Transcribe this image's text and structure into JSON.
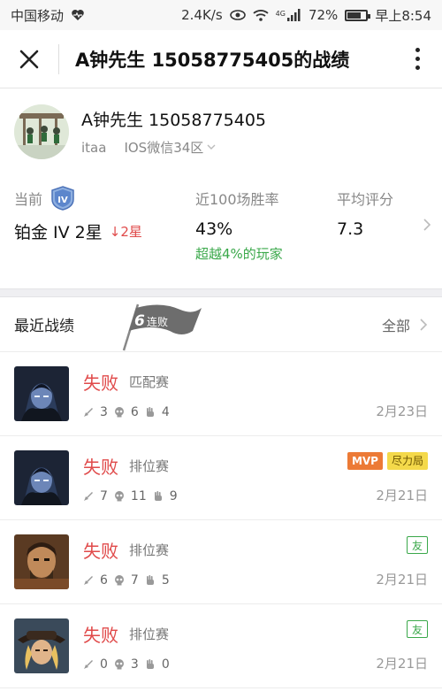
{
  "status_bar": {
    "carrier": "中国移动",
    "speed": "2.4K/s",
    "network": "4G",
    "battery": "72%",
    "battery_level": 0.72,
    "time": "早上8:54"
  },
  "navbar": {
    "title": "A钟先生 15058775405的战绩"
  },
  "profile": {
    "name": "A钟先生 15058775405",
    "account": "itaa",
    "server": "IOS微信34区",
    "rank_label": "当前",
    "rank_badge": "IV",
    "rank_value": "铂金 IV 2星",
    "rank_change": "↓2星",
    "winrate_label": "近100场胜率",
    "winrate_value": "43%",
    "winrate_note": "超越4%的玩家",
    "score_label": "平均评分",
    "score_value": "7.3"
  },
  "recent": {
    "title": "最近战绩",
    "streak_count": "6",
    "streak_label": "连败",
    "all_label": "全部"
  },
  "matches": [
    {
      "result": "失败",
      "type": "匹配赛",
      "kills": "3",
      "deaths": "6",
      "assists": "4",
      "date": "2月23日",
      "badges": []
    },
    {
      "result": "失败",
      "type": "排位赛",
      "kills": "7",
      "deaths": "11",
      "assists": "9",
      "date": "2月21日",
      "badges": [
        "MVP",
        "尽力局"
      ]
    },
    {
      "result": "失败",
      "type": "排位赛",
      "kills": "6",
      "deaths": "7",
      "assists": "5",
      "date": "2月21日",
      "badges": [
        "友"
      ]
    },
    {
      "result": "失败",
      "type": "排位赛",
      "kills": "0",
      "deaths": "3",
      "assists": "0",
      "date": "2月21日",
      "badges": [
        "友"
      ]
    }
  ],
  "colors": {
    "loss": "#e04a4a",
    "positive": "#3aa84a",
    "mvp": "#ec7a36",
    "effort": "#f4d94a"
  }
}
